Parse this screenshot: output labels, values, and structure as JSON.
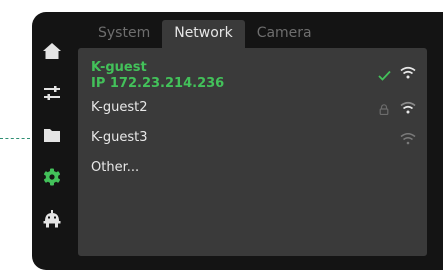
{
  "tabs": [
    {
      "label": "System",
      "active": false
    },
    {
      "label": "Network",
      "active": true
    },
    {
      "label": "Camera",
      "active": false
    }
  ],
  "sidebar": {
    "items": [
      {
        "icon": "home-icon"
      },
      {
        "icon": "sliders-icon"
      },
      {
        "icon": "folder-icon"
      },
      {
        "icon": "gear-icon",
        "active": true
      },
      {
        "icon": "robot-icon"
      }
    ]
  },
  "networks": [
    {
      "name": "K-guest",
      "ip": "IP  172.23.214.236",
      "connected": true,
      "locked": false
    },
    {
      "name": "K-guest2",
      "connected": false,
      "locked": true
    },
    {
      "name": "K-guest3",
      "connected": false,
      "locked": false
    }
  ],
  "other_label": "Other...",
  "colors": {
    "accent": "#43c15a",
    "device_bg": "#141414",
    "panel_bg": "#3a3a3a",
    "leader_line": "#2f8f73"
  }
}
